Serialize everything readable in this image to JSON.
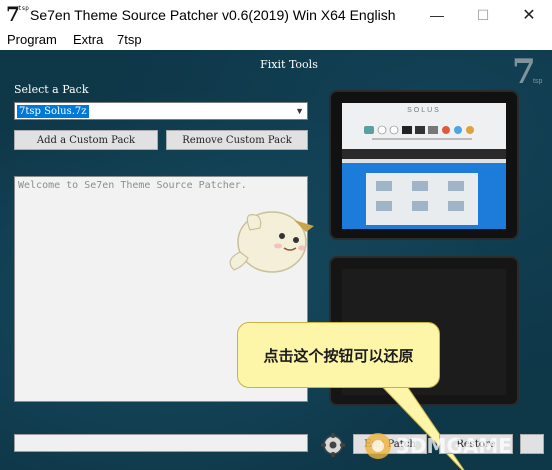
{
  "window": {
    "title": "Se7en Theme Source Patcher v0.6(2019) Win X64 English",
    "icon": {
      "seven": "7",
      "tsp": "tsp"
    },
    "controls": {
      "minimize": "—",
      "maximize": "☐",
      "close": "✕"
    }
  },
  "menu": {
    "items": [
      "Program",
      "Extra",
      "7tsp"
    ]
  },
  "main": {
    "section_title": "Fixit Tools",
    "logo": {
      "seven": "7",
      "tsp": "tsp"
    },
    "select_label": "Select a Pack",
    "selected_pack": "7tsp Solus.7z",
    "add_button": "Add a Custom Pack",
    "remove_button": "Remove Custom Pack",
    "log_text": "Welcome to Se7en Theme Source Patcher.",
    "preview_text": "SOLUS"
  },
  "tooltip": {
    "text": "点击这个按钮可以还原"
  },
  "bottom": {
    "path_value": "",
    "patch_button": "Eng Patch",
    "restore_button": "Restore",
    "extra_button": ""
  },
  "watermark": {
    "text": "3DMGAME"
  },
  "colors": {
    "background": "#0e3748",
    "selection": "#0078d7",
    "tooltip_bg": "#fdf5a8",
    "preview_blue": "#1d7bd9"
  }
}
